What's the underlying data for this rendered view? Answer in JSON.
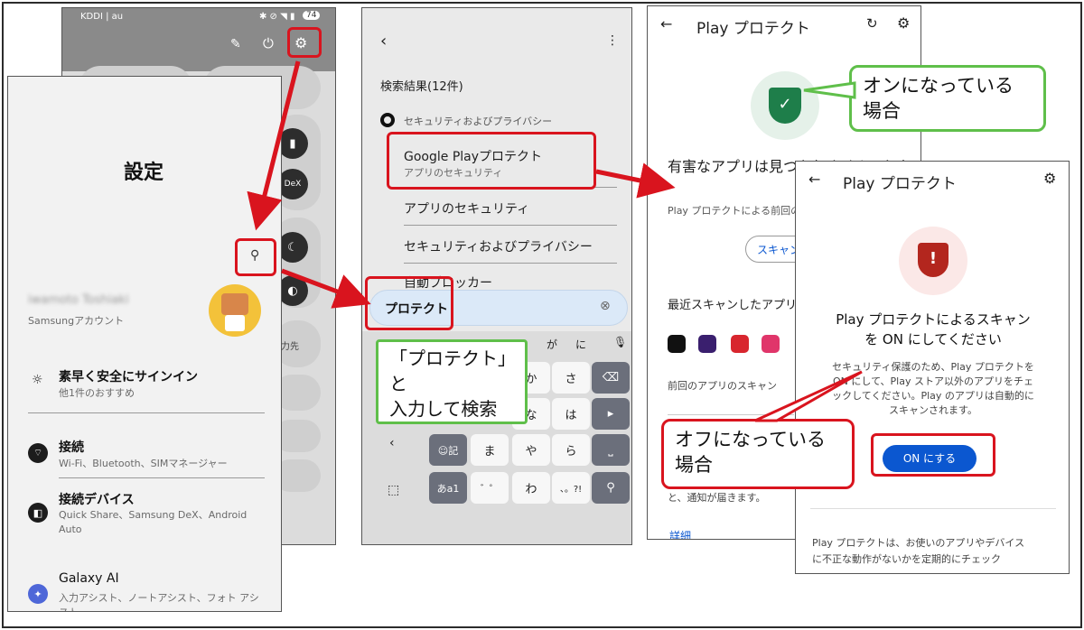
{
  "quick_panel": {
    "carrier": "KDDI | au",
    "battery": "74",
    "tile_dex": "DeX",
    "tile_partial": "力先"
  },
  "settings": {
    "title": "設定",
    "account_name": "iwamoto Toshiaki",
    "account_sub": "Samsungアカウント",
    "items": [
      {
        "title": "素早く安全にサインイン",
        "sub": "他1件のおすすめ"
      },
      {
        "title": "接続",
        "sub": "Wi-Fi、Bluetooth、SIMマネージャー"
      },
      {
        "title": "接続デバイス",
        "sub": "Quick Share、Samsung DeX、Android Auto"
      },
      {
        "title": "Galaxy AI",
        "sub": "入力アシスト、ノートアシスト、フォト アシスト"
      }
    ]
  },
  "search": {
    "results_label": "検索結果(12件)",
    "category": "セキュリティおよびプライバシー",
    "result1_title": "Google Playプロテクト",
    "result1_sub": "アプリのセキュリティ",
    "result2": "アプリのセキュリティ",
    "result3": "セキュリティおよびプライバシー",
    "result4": "自動ブロッカー",
    "query": "プロテクト",
    "callout": [
      "「プロテクト」",
      "と",
      "入力して検索"
    ],
    "keys": {
      "row1": [
        "か",
        "さ"
      ],
      "row2": [
        "な",
        "は"
      ],
      "row3": [
        "ま",
        "や",
        "ら"
      ],
      "row4": [
        "わ"
      ],
      "emoji_key": "☺記",
      "kana_key": "あa1",
      "suggest": [
        "が",
        "に"
      ]
    }
  },
  "play_protect_on": {
    "title": "Play プロテクト",
    "headline": "有害なアプリは見つかりませんでした",
    "sub": "Play プロテクトによる前回のスキャン",
    "scan_button": "スキャン",
    "recent": "最近スキャンしたアプリ",
    "last_scan": "前回のアプリのスキャン",
    "notify": "と、通知が届きます。",
    "details_link": "詳細",
    "callout": [
      "オンになっている",
      "場合"
    ]
  },
  "play_protect_off": {
    "title": "Play プロテクト",
    "headline": [
      "Play プロテクトによるスキャン",
      "を ON にしてください"
    ],
    "body": [
      "セキュリティ保護のため、Play プロテクトを",
      "ON にして、Play ストア以外のアプリをチェ",
      "ックしてください。Play のアプリは自動的に",
      "スキャンされます。"
    ],
    "on_button": "ON にする",
    "footer": [
      "Play プロテクトは、お使いのアプリやデバイス",
      "に不正な動作がないかを定期的にチェック"
    ],
    "callout": [
      "オフになっている",
      "場合"
    ]
  },
  "colors": {
    "annotation_red": "#d9141e",
    "annotation_green": "#5fbf4a",
    "google_green": "#1e7e4a",
    "warning_red": "#b3261e",
    "on_button_blue": "#0b57d0"
  }
}
